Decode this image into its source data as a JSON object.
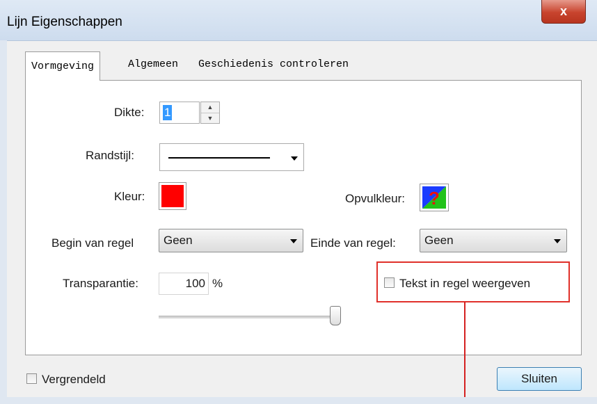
{
  "window": {
    "title": "Lijn Eigenschappen",
    "close_glyph": "x"
  },
  "tabs": [
    {
      "label": "Vormgeving",
      "active": true
    },
    {
      "label": "Algemeen",
      "active": false
    },
    {
      "label": "Geschiedenis controleren",
      "active": false
    }
  ],
  "form": {
    "thickness_label": "Dikte:",
    "thickness_value": "1",
    "border_style_label": "Randstijl:",
    "color_label": "Kleur:",
    "color_value": "#ff0000",
    "fill_color_label": "Opvulkleur:",
    "line_start_label": "Begin van regel",
    "line_start_value": "Geen",
    "line_end_label": "Einde van regel:",
    "line_end_value": "Geen",
    "opacity_label": "Transparantie:",
    "opacity_value": "100",
    "opacity_unit": "%",
    "opacity_slider_level": 1.0,
    "show_text_label": "Tekst in regel weergeven",
    "show_text_checked": false
  },
  "footer": {
    "locked_label": "Vergrendeld",
    "locked_checked": false,
    "close_label": "Sluiten"
  },
  "colors": {
    "annotation_red": "#e0302a",
    "accent_blue": "#3399ff"
  },
  "icons": {
    "fill_color": "no-fill-question-icon",
    "dropdown": "chevron-down-icon",
    "spinner": "spinner-arrows-icon"
  }
}
